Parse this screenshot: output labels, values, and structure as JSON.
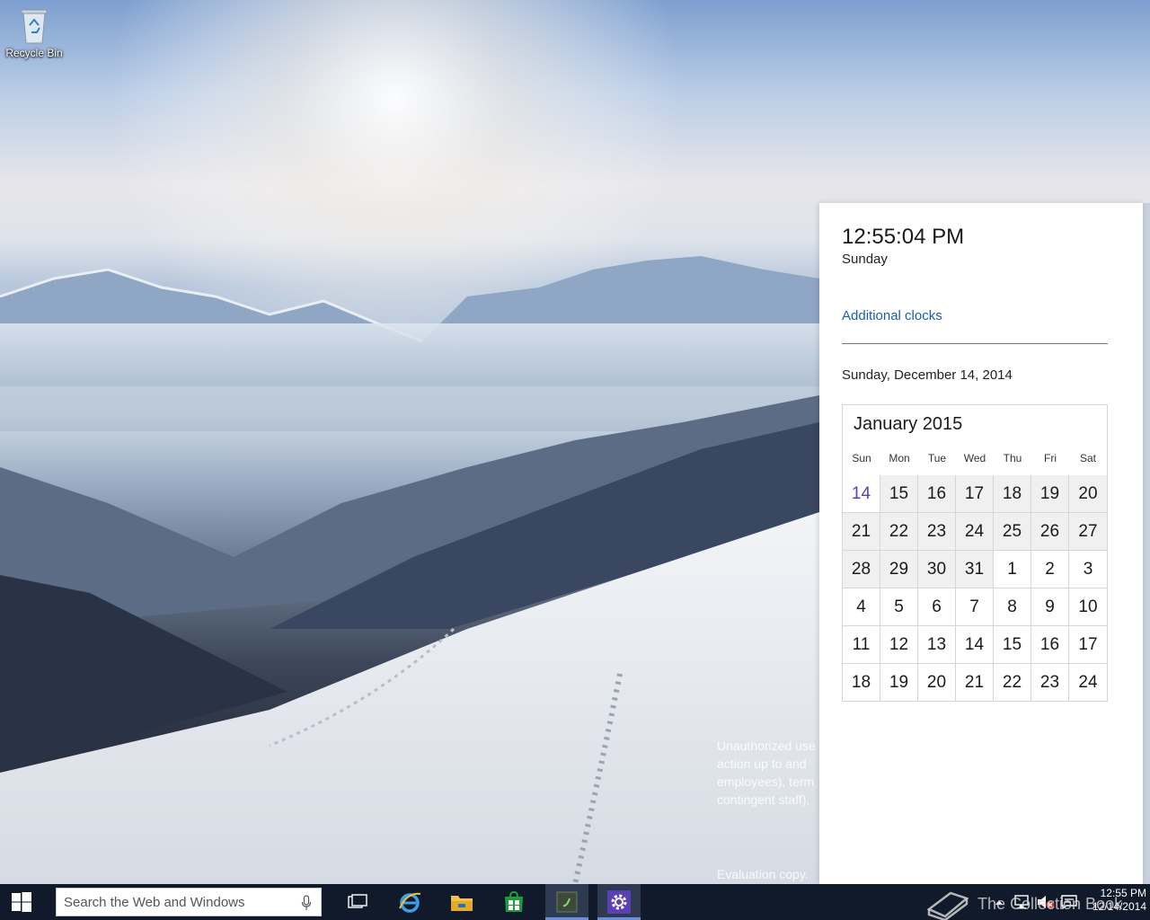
{
  "desktop": {
    "icons": [
      {
        "label": "Recycle Bin"
      }
    ],
    "legal_lines": "Unauthorized use\naction up to and\nemployees), term\ncontingent staff),",
    "evaluation_text": "Evaluation copy."
  },
  "clock_flyout": {
    "time": "12:55:04 PM",
    "day": "Sunday",
    "additional_clocks_link": "Additional clocks",
    "full_date": "Sunday, December 14, 2014",
    "calendar": {
      "header": "January 2015",
      "weekdays": [
        "Sun",
        "Mon",
        "Tue",
        "Wed",
        "Thu",
        "Fri",
        "Sat"
      ],
      "weeks": [
        [
          {
            "d": "14",
            "state": "today"
          },
          {
            "d": "15",
            "state": "other"
          },
          {
            "d": "16",
            "state": "other"
          },
          {
            "d": "17",
            "state": "other"
          },
          {
            "d": "18",
            "state": "other"
          },
          {
            "d": "19",
            "state": "other"
          },
          {
            "d": "20",
            "state": "other"
          }
        ],
        [
          {
            "d": "21",
            "state": "other"
          },
          {
            "d": "22",
            "state": "other"
          },
          {
            "d": "23",
            "state": "other"
          },
          {
            "d": "24",
            "state": "other"
          },
          {
            "d": "25",
            "state": "other"
          },
          {
            "d": "26",
            "state": "other"
          },
          {
            "d": "27",
            "state": "other"
          }
        ],
        [
          {
            "d": "28",
            "state": "other"
          },
          {
            "d": "29",
            "state": "other"
          },
          {
            "d": "30",
            "state": "other"
          },
          {
            "d": "31",
            "state": "other"
          },
          {
            "d": "1",
            "state": "current"
          },
          {
            "d": "2",
            "state": "current"
          },
          {
            "d": "3",
            "state": "current"
          }
        ],
        [
          {
            "d": "4",
            "state": "current"
          },
          {
            "d": "5",
            "state": "current"
          },
          {
            "d": "6",
            "state": "current"
          },
          {
            "d": "7",
            "state": "current"
          },
          {
            "d": "8",
            "state": "current"
          },
          {
            "d": "9",
            "state": "current"
          },
          {
            "d": "10",
            "state": "current"
          }
        ],
        [
          {
            "d": "11",
            "state": "current"
          },
          {
            "d": "12",
            "state": "current"
          },
          {
            "d": "13",
            "state": "current"
          },
          {
            "d": "14",
            "state": "current"
          },
          {
            "d": "15",
            "state": "current"
          },
          {
            "d": "16",
            "state": "current"
          },
          {
            "d": "17",
            "state": "current"
          }
        ],
        [
          {
            "d": "18",
            "state": "current"
          },
          {
            "d": "19",
            "state": "current"
          },
          {
            "d": "20",
            "state": "current"
          },
          {
            "d": "21",
            "state": "current"
          },
          {
            "d": "22",
            "state": "current"
          },
          {
            "d": "23",
            "state": "current"
          },
          {
            "d": "24",
            "state": "current"
          }
        ]
      ]
    }
  },
  "taskbar": {
    "search_placeholder": "Search the Web and Windows",
    "pinned": [
      {
        "icon": "task-view-icon",
        "active": false
      },
      {
        "icon": "internet-explorer-icon",
        "active": false
      },
      {
        "icon": "file-explorer-icon",
        "active": false
      },
      {
        "icon": "store-icon",
        "active": false
      },
      {
        "icon": "app-icon",
        "active": true
      },
      {
        "icon": "settings-gear-icon",
        "active": true
      }
    ],
    "tray_icons": [
      "show-hidden-icons-chevron",
      "network-icon",
      "volume-muted-icon",
      "action-center-icon"
    ],
    "clock_time": "12:55 PM",
    "clock_date": "12/14/2014"
  },
  "watermark": {
    "text": "The Collection Book"
  },
  "colors": {
    "accent_link": "#1c5fa8",
    "today": "#5b3fb5",
    "taskbar": "#101a2b",
    "store_green": "#1e9b3c"
  }
}
